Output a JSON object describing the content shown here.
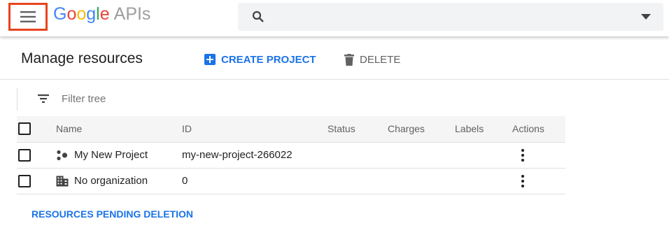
{
  "header": {
    "menu_icon": "hamburger-menu-icon",
    "logo": {
      "letters": [
        "G",
        "o",
        "o",
        "g",
        "l",
        "e"
      ],
      "suffix": "APIs"
    },
    "search": {
      "icon": "search-icon",
      "placeholder": "",
      "dropdown_icon": "caret-down-icon"
    }
  },
  "toolbar": {
    "title": "Manage resources",
    "create_label": "CREATE PROJECT",
    "delete_label": "DELETE"
  },
  "filter": {
    "icon": "filter-icon",
    "placeholder": "Filter tree"
  },
  "table": {
    "columns": [
      "Name",
      "ID",
      "Status",
      "Charges",
      "Labels",
      "Actions"
    ],
    "rows": [
      {
        "icon": "project-icon",
        "name": "My New Project",
        "id": "my-new-project-266022",
        "status": "",
        "charges": "",
        "labels": ""
      },
      {
        "icon": "organization-icon",
        "name": "No organization",
        "id": "0",
        "status": "",
        "charges": "",
        "labels": ""
      }
    ]
  },
  "footer": {
    "pending_label": "RESOURCES PENDING DELETION"
  },
  "colors": {
    "accent": "#1a73e8",
    "highlight": "#e8441f"
  }
}
